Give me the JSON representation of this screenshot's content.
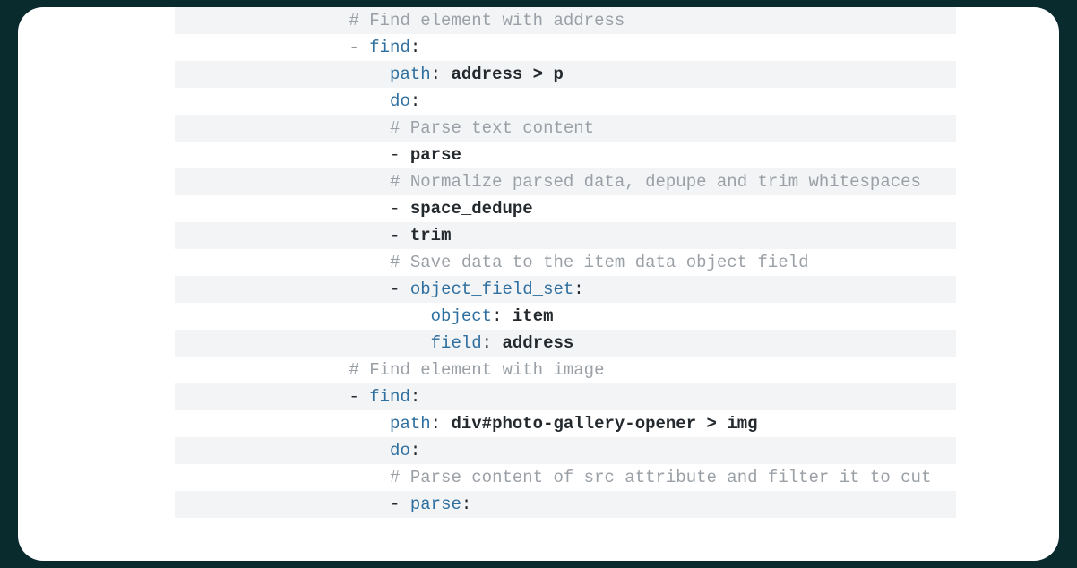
{
  "lines": [
    {
      "indent": 16,
      "segments": [
        {
          "cls": "c",
          "text": "# Find element with address"
        }
      ]
    },
    {
      "indent": 16,
      "segments": [
        {
          "cls": "p",
          "text": "- "
        },
        {
          "cls": "k",
          "text": "find"
        },
        {
          "cls": "p",
          "text": ":"
        }
      ]
    },
    {
      "indent": 20,
      "segments": [
        {
          "cls": "k",
          "text": "path"
        },
        {
          "cls": "p",
          "text": ": "
        },
        {
          "cls": "v",
          "text": "address > p"
        }
      ]
    },
    {
      "indent": 20,
      "segments": [
        {
          "cls": "k",
          "text": "do"
        },
        {
          "cls": "p",
          "text": ":"
        }
      ]
    },
    {
      "indent": 20,
      "segments": [
        {
          "cls": "c",
          "text": "# Parse text content"
        }
      ]
    },
    {
      "indent": 20,
      "segments": [
        {
          "cls": "p",
          "text": "- "
        },
        {
          "cls": "v",
          "text": "parse"
        }
      ]
    },
    {
      "indent": 20,
      "segments": [
        {
          "cls": "c",
          "text": "# Normalize parsed data, depupe and trim whitespaces"
        }
      ]
    },
    {
      "indent": 20,
      "segments": [
        {
          "cls": "p",
          "text": "- "
        },
        {
          "cls": "v",
          "text": "space_dedupe"
        }
      ]
    },
    {
      "indent": 20,
      "segments": [
        {
          "cls": "p",
          "text": "- "
        },
        {
          "cls": "v",
          "text": "trim"
        }
      ]
    },
    {
      "indent": 20,
      "segments": [
        {
          "cls": "c",
          "text": "# Save data to the item data object field"
        }
      ]
    },
    {
      "indent": 20,
      "segments": [
        {
          "cls": "p",
          "text": "- "
        },
        {
          "cls": "k",
          "text": "object_field_set"
        },
        {
          "cls": "p",
          "text": ":"
        }
      ]
    },
    {
      "indent": 24,
      "segments": [
        {
          "cls": "k",
          "text": "object"
        },
        {
          "cls": "p",
          "text": ": "
        },
        {
          "cls": "v",
          "text": "item"
        }
      ]
    },
    {
      "indent": 24,
      "segments": [
        {
          "cls": "k",
          "text": "field"
        },
        {
          "cls": "p",
          "text": ": "
        },
        {
          "cls": "v",
          "text": "address"
        }
      ]
    },
    {
      "indent": 16,
      "segments": [
        {
          "cls": "c",
          "text": "# Find element with image"
        }
      ]
    },
    {
      "indent": 16,
      "segments": [
        {
          "cls": "p",
          "text": "- "
        },
        {
          "cls": "k",
          "text": "find"
        },
        {
          "cls": "p",
          "text": ":"
        }
      ]
    },
    {
      "indent": 20,
      "segments": [
        {
          "cls": "k",
          "text": "path"
        },
        {
          "cls": "p",
          "text": ": "
        },
        {
          "cls": "v",
          "text": "div#photo-gallery-opener > img"
        }
      ]
    },
    {
      "indent": 20,
      "segments": [
        {
          "cls": "k",
          "text": "do"
        },
        {
          "cls": "p",
          "text": ":"
        }
      ]
    },
    {
      "indent": 20,
      "segments": [
        {
          "cls": "c",
          "text": "# Parse content of src attribute and filter it to cut"
        }
      ]
    },
    {
      "indent": 20,
      "segments": [
        {
          "cls": "p",
          "text": "- "
        },
        {
          "cls": "k",
          "text": "parse"
        },
        {
          "cls": "p",
          "text": ":"
        }
      ]
    }
  ]
}
